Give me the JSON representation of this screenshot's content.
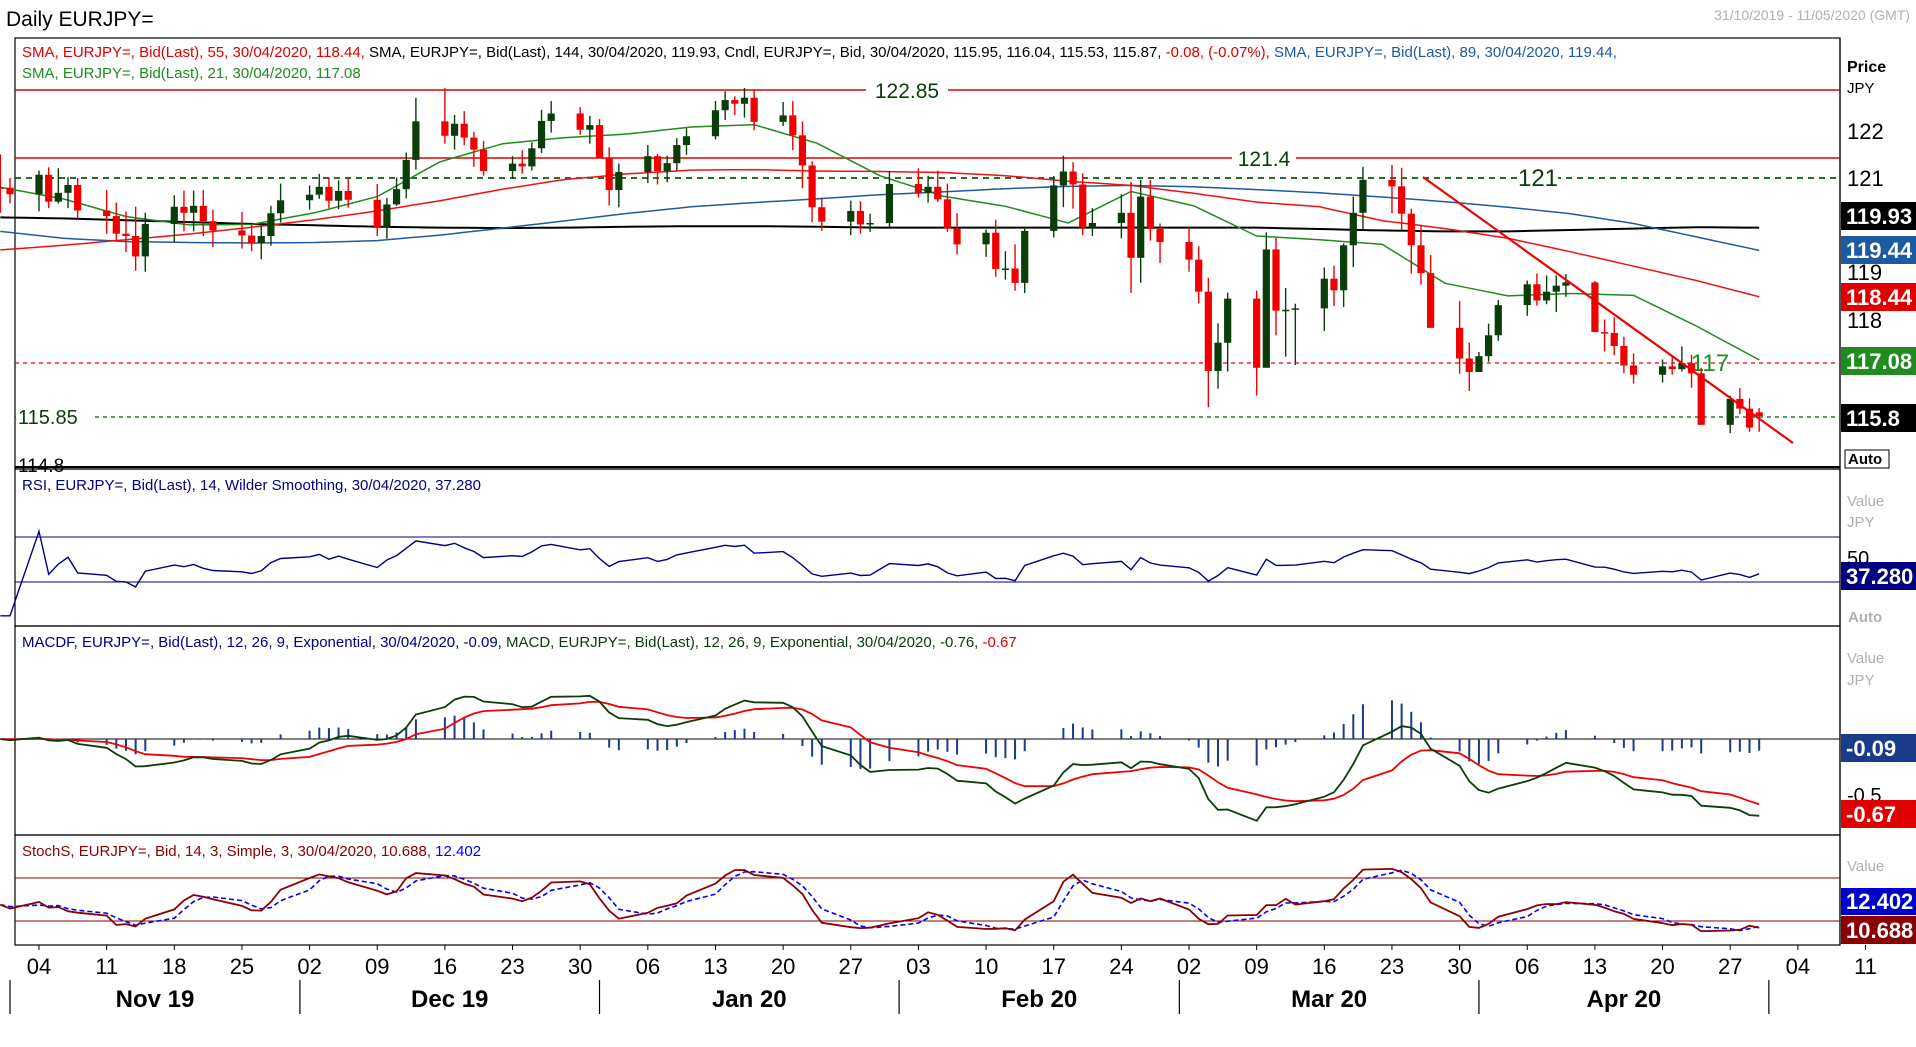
{
  "window": {
    "title": "Daily EURJPY=",
    "date_range": "31/10/2019 - 11/05/2020 (GMT)"
  },
  "colors": {
    "up_candle": "#0a3d0a",
    "down_candle": "#f00000",
    "sma55": "#f01010",
    "sma144": "#000000",
    "sma89": "#1e5aa0",
    "sma21": "#1e8c1e",
    "rsi": "#000080",
    "macd": "#0a3d0a",
    "macd_signal": "#f00000",
    "hist": "#1a3a8a",
    "stoch_k": "#8b0000",
    "stoch_d": "#0000ff",
    "level_red": "#e00000",
    "level_green": "#0a5a0a",
    "trendline": "#f00000"
  },
  "price_panel": {
    "legend_line1": {
      "part1": "SMA, EURJPY=, Bid(Last),  55, 30/04/2020, 118.44, ",
      "part2": "SMA, EURJPY=, Bid(Last),   144, 30/04/2020, 119.93, ",
      "part3": "Cndl, EURJPY=, Bid, 30/04/2020, 115.95, 116.04, 115.53, 115.87, ",
      "part4": "-0.08, (-0.07%), ",
      "part5": "SMA, EURJPY=, Bid(Last),   89, 30/04/2020, 119.44,"
    },
    "legend_line2": "SMA, EURJPY=, Bid(Last),  21, 30/04/2020, 117.08",
    "axis_title": "Price",
    "axis_unit": "JPY",
    "axis_ticks": [
      122,
      121,
      118
    ],
    "axis_tick_labels": [
      "122",
      "121",
      "118"
    ],
    "badges": {
      "sma144": "119.93",
      "sma89": "119.44",
      "sma55": "118.44",
      "sma21": "117.08",
      "close": "115.8",
      "partial": "119",
      "auto": "Auto"
    },
    "levels": [
      {
        "value": 122.85,
        "label": "122.85",
        "style": "solid-red"
      },
      {
        "value": 121.4,
        "label": "121.4",
        "style": "solid-red"
      },
      {
        "value": 121,
        "label": "121",
        "style": "dashed-green"
      },
      {
        "value": 117,
        "label": "117",
        "style": "dashed-red"
      },
      {
        "value": 115.85,
        "label": "115.85",
        "style": "dashed-green"
      }
    ],
    "bottom_label": "114.8"
  },
  "rsi_panel": {
    "legend": "RSI, EURJPY=, Bid(Last),  14, Wilder Smoothing, 30/04/2020, 37.280",
    "axis_labels": [
      "Value",
      "JPY",
      "50"
    ],
    "badge": "37.280",
    "auto": "Auto"
  },
  "macd_panel": {
    "legend": {
      "part1": "MACDF, EURJPY=, Bid(Last),  12, 26, 9, Exponential, 30/04/2020, -0.09, ",
      "part2": "MACD, EURJPY=, Bid(Last),  12, 26, 9, Exponential, 30/04/2020, -0.76, ",
      "part3": "-0.67"
    },
    "axis_labels": [
      "Value",
      "JPY",
      "-0.5"
    ],
    "badges": {
      "hist": "-0.09",
      "signal": "-0.67"
    }
  },
  "stoch_panel": {
    "legend": {
      "part1": "StochS, EURJPY=, Bid,  14, 3, Simple, 3, 30/04/2020, 10.688, ",
      "part2": "12.402"
    },
    "axis_labels": [
      "Value",
      "JPY"
    ],
    "badges": {
      "d": "12.402",
      "k": "10.688"
    }
  },
  "x_axis": {
    "day_labels": [
      "04",
      "11",
      "18",
      "25",
      "02",
      "09",
      "16",
      "23",
      "30",
      "06",
      "13",
      "20",
      "27",
      "03",
      "10",
      "17",
      "24",
      "02",
      "09",
      "16",
      "23",
      "30",
      "06",
      "13",
      "20",
      "27",
      "04",
      "11"
    ],
    "month_labels": [
      "Nov 19",
      "Dec 19",
      "Jan 20",
      "Feb 20",
      "Mar 20",
      "Apr 20"
    ]
  },
  "chart_data": {
    "type": "candlestick",
    "title": "Daily EURJPY=",
    "ylabel": "Price JPY",
    "ylim": [
      114.8,
      123.0
    ],
    "grid": false,
    "first_date": "2019-10-31",
    "last_date": "2020-04-30",
    "candles": [
      [
        120.8,
        121.51,
        120.25,
        120.79
      ],
      [
        120.79,
        121.0,
        120.45,
        120.65
      ],
      [
        120.65,
        121.16,
        120.28,
        121.07
      ],
      [
        121.07,
        121.23,
        120.35,
        120.49
      ],
      [
        120.49,
        121.21,
        120.45,
        120.68
      ],
      [
        120.68,
        121.02,
        120.35,
        120.85
      ],
      [
        120.85,
        121.0,
        120.12,
        120.3
      ],
      [
        120.3,
        120.74,
        119.8,
        120.18
      ],
      [
        120.18,
        120.47,
        119.65,
        119.8
      ],
      [
        119.8,
        120.28,
        119.4,
        119.75
      ],
      [
        119.75,
        120.38,
        119.0,
        119.31
      ],
      [
        119.31,
        120.25,
        118.98,
        120.01
      ],
      [
        120.01,
        120.63,
        119.62,
        120.38
      ],
      [
        120.38,
        120.73,
        119.85,
        120.25
      ],
      [
        120.25,
        120.73,
        119.85,
        120.4
      ],
      [
        120.4,
        120.74,
        119.75,
        120.07
      ],
      [
        120.07,
        120.32,
        119.51,
        119.87
      ],
      [
        119.87,
        120.27,
        119.48,
        119.76
      ],
      [
        119.76,
        120.0,
        119.42,
        119.6
      ],
      [
        119.6,
        120.0,
        119.25,
        119.75
      ],
      [
        119.75,
        120.4,
        119.54,
        120.24
      ],
      [
        120.24,
        120.88,
        120.04,
        120.52
      ],
      [
        120.52,
        120.84,
        120.32,
        120.64
      ],
      [
        120.64,
        121.09,
        120.55,
        120.81
      ],
      [
        120.81,
        121.01,
        120.35,
        120.51
      ],
      [
        120.51,
        120.95,
        120.33,
        120.72
      ],
      [
        120.72,
        120.98,
        120.36,
        120.53
      ],
      [
        120.53,
        120.87,
        119.75,
        119.94
      ],
      [
        119.94,
        120.57,
        119.69,
        120.43
      ],
      [
        120.43,
        121.01,
        120.4,
        120.76
      ],
      [
        120.76,
        121.55,
        120.56,
        121.39
      ],
      [
        121.39,
        122.73,
        121.18,
        122.22
      ],
      [
        122.22,
        122.94,
        121.74,
        121.91
      ],
      [
        121.91,
        122.36,
        121.61,
        122.17
      ],
      [
        122.17,
        122.44,
        121.71,
        121.87
      ],
      [
        121.87,
        122.0,
        121.24,
        121.61
      ],
      [
        121.61,
        121.8,
        121.05,
        121.15
      ],
      [
        121.15,
        121.47,
        120.98,
        121.31
      ],
      [
        121.31,
        121.6,
        121.09,
        121.25
      ],
      [
        121.25,
        121.77,
        121.16,
        121.64
      ],
      [
        121.64,
        122.47,
        121.54,
        122.23
      ],
      [
        122.23,
        122.66,
        121.98,
        122.39
      ],
      [
        122.39,
        122.53,
        121.93,
        122.04
      ],
      [
        122.04,
        122.34,
        121.74,
        122.14
      ],
      [
        122.14,
        122.27,
        121.67,
        121.44
      ],
      [
        121.44,
        121.66,
        120.41,
        120.74
      ],
      [
        120.74,
        121.31,
        120.37,
        121.13
      ],
      [
        121.13,
        121.71,
        120.89,
        121.47
      ],
      [
        121.47,
        121.52,
        120.86,
        121.15
      ],
      [
        121.15,
        121.48,
        120.91,
        121.32
      ],
      [
        121.32,
        121.86,
        121.16,
        121.71
      ],
      [
        121.71,
        122.07,
        121.5,
        121.9
      ],
      [
        121.9,
        122.66,
        121.83,
        122.46
      ],
      [
        122.46,
        122.87,
        122.25,
        122.68
      ],
      [
        122.68,
        122.76,
        122.36,
        122.6
      ],
      [
        122.6,
        122.94,
        122.3,
        122.73
      ],
      [
        122.73,
        122.91,
        122.03,
        122.21
      ],
      [
        122.21,
        122.64,
        122.12,
        122.35
      ],
      [
        122.35,
        122.66,
        121.6,
        121.92
      ],
      [
        121.92,
        122.22,
        120.78,
        121.27
      ],
      [
        121.27,
        121.36,
        120.05,
        120.37
      ],
      [
        120.37,
        120.58,
        119.86,
        120.06
      ],
      [
        120.06,
        120.51,
        119.77,
        120.29
      ],
      [
        120.29,
        120.5,
        119.8,
        120.0
      ],
      [
        120.0,
        120.23,
        119.84,
        120.03
      ],
      [
        120.03,
        121.15,
        119.95,
        120.87
      ],
      [
        120.87,
        121.21,
        120.58,
        120.68
      ],
      [
        120.68,
        121.05,
        120.47,
        120.81
      ],
      [
        120.81,
        121.16,
        120.48,
        120.54
      ],
      [
        120.54,
        120.88,
        119.84,
        119.91
      ],
      [
        119.91,
        120.24,
        119.35,
        119.57
      ],
      [
        119.57,
        119.89,
        119.3,
        119.82
      ],
      [
        119.82,
        120.1,
        118.87,
        119.04
      ],
      [
        119.04,
        119.42,
        118.81,
        119.05
      ],
      [
        119.05,
        119.57,
        118.57,
        118.74
      ],
      [
        118.74,
        119.95,
        118.52,
        119.86
      ],
      [
        119.86,
        121.04,
        119.72,
        120.84
      ],
      [
        120.84,
        121.48,
        120.37,
        121.14
      ],
      [
        121.14,
        121.34,
        120.34,
        120.86
      ],
      [
        120.86,
        121.1,
        119.77,
        119.93
      ],
      [
        119.93,
        120.35,
        119.75,
        120.03
      ],
      [
        120.03,
        120.65,
        119.7,
        120.25
      ],
      [
        120.25,
        120.92,
        118.52,
        119.28
      ],
      [
        119.28,
        120.96,
        118.74,
        120.6
      ],
      [
        120.6,
        120.96,
        119.65,
        119.9
      ],
      [
        119.9,
        120.02,
        119.17,
        119.62
      ],
      [
        119.62,
        119.95,
        118.98,
        119.24
      ],
      [
        119.24,
        119.53,
        118.3,
        118.55
      ],
      [
        118.55,
        118.85,
        116.06,
        116.84
      ],
      [
        116.84,
        117.87,
        116.46,
        117.45
      ],
      [
        117.45,
        118.53,
        116.83,
        118.4
      ],
      [
        118.4,
        118.57,
        116.31,
        116.91
      ],
      [
        116.91,
        119.83,
        116.92,
        119.46
      ],
      [
        119.46,
        119.71,
        117.61,
        118.14
      ],
      [
        118.14,
        118.63,
        117.15,
        118.16
      ],
      [
        118.16,
        118.29,
        116.97,
        118.19
      ],
      [
        118.19,
        119.07,
        117.7,
        118.83
      ],
      [
        118.83,
        119.11,
        118.24,
        118.58
      ],
      [
        118.58,
        119.59,
        118.22,
        119.55
      ],
      [
        119.55,
        120.6,
        119.08,
        120.25
      ],
      [
        120.25,
        121.24,
        119.88,
        120.96
      ],
      [
        120.96,
        121.28,
        120.24,
        120.82
      ],
      [
        120.82,
        121.22,
        119.89,
        120.23
      ],
      [
        120.23,
        120.34,
        118.94,
        119.55
      ],
      [
        119.55,
        119.98,
        118.7,
        118.95
      ],
      [
        118.95,
        119.34,
        118.02,
        117.77
      ],
      [
        117.77,
        118.35,
        116.78,
        117.11
      ],
      [
        117.11,
        117.45,
        116.41,
        116.82
      ],
      [
        116.82,
        117.25,
        116.95,
        117.16
      ],
      [
        117.16,
        117.86,
        117.04,
        117.61
      ],
      [
        117.61,
        118.37,
        117.49,
        118.26
      ],
      [
        118.26,
        118.79,
        118.03,
        118.71
      ],
      [
        118.71,
        118.94,
        118.25,
        118.36
      ],
      [
        118.36,
        118.9,
        118.28,
        118.55
      ],
      [
        118.55,
        118.9,
        118.11,
        118.68
      ],
      [
        118.68,
        118.93,
        118.44,
        118.75
      ],
      [
        118.75,
        118.78,
        117.8,
        117.68
      ],
      [
        117.68,
        117.95,
        117.26,
        117.66
      ],
      [
        117.66,
        118.0,
        117.18,
        117.38
      ],
      [
        117.38,
        117.58,
        116.79,
        116.96
      ],
      [
        116.96,
        117.22,
        116.57,
        116.76
      ],
      [
        116.76,
        117.09,
        116.59,
        116.94
      ],
      [
        116.94,
        117.16,
        116.76,
        116.88
      ],
      [
        116.88,
        117.37,
        116.83,
        117.01
      ],
      [
        117.01,
        117.19,
        116.48,
        116.79
      ],
      [
        116.79,
        116.91,
        116.08,
        115.68
      ],
      [
        115.68,
        116.31,
        115.5,
        116.24
      ],
      [
        116.24,
        116.47,
        115.91,
        116.03
      ],
      [
        116.03,
        116.25,
        115.53,
        115.62
      ],
      [
        115.95,
        116.04,
        115.53,
        115.87
      ]
    ],
    "series": [
      {
        "name": "SMA 144",
        "values": [
          120.15,
          120.13,
          120.09,
          120.05,
          120.01,
          119.98,
          119.95,
          119.93,
          119.92,
          119.93,
          119.95,
          119.96,
          119.96,
          119.95,
          119.93,
          119.93,
          119.93,
          119.93,
          119.93,
          119.93,
          119.93,
          119.9,
          119.87,
          119.85,
          119.85,
          119.88,
          119.91,
          119.94,
          119.93
        ]
      },
      {
        "name": "SMA 89",
        "values": [
          119.85,
          119.7,
          119.63,
          119.61,
          119.6,
          119.61,
          119.65,
          119.77,
          119.92,
          120.08,
          120.24,
          120.38,
          120.47,
          120.55,
          120.64,
          120.7,
          120.77,
          120.82,
          120.84,
          120.81,
          120.75,
          120.68,
          120.59,
          120.49,
          120.37,
          120.23,
          120.02,
          119.73,
          119.44
        ]
      },
      {
        "name": "SMA 55",
        "values": [
          119.45,
          119.55,
          119.67,
          119.79,
          119.94,
          120.1,
          120.29,
          120.51,
          120.76,
          120.97,
          121.09,
          121.17,
          121.18,
          121.15,
          121.14,
          121.12,
          121.05,
          120.93,
          120.84,
          120.67,
          120.48,
          120.38,
          120.08,
          119.91,
          119.7,
          119.41,
          119.1,
          118.79,
          118.44
        ]
      },
      {
        "name": "SMA 21",
        "values": [
          120.8,
          120.55,
          120.17,
          119.99,
          120.0,
          120.25,
          120.6,
          121.35,
          121.74,
          121.87,
          121.95,
          122.1,
          122.15,
          121.75,
          121.05,
          120.61,
          120.39,
          120.03,
          120.71,
          120.4,
          119.75,
          119.67,
          119.57,
          118.73,
          118.46,
          118.51,
          118.47,
          117.81,
          117.08
        ]
      }
    ],
    "sub_panels": {
      "rsi": {
        "period": 14,
        "levels": [
          30,
          70
        ],
        "last": 37.28
      },
      "macd": {
        "fast": 12,
        "slow": 26,
        "signal": 9,
        "macd_last": -0.76,
        "signal_last": -0.67,
        "hist_last": -0.09
      },
      "stoch": {
        "k_period": 14,
        "smooth": 3,
        "d_period": 3,
        "k_last": 10.688,
        "d_last": 12.402,
        "levels": [
          20,
          80
        ]
      }
    }
  }
}
